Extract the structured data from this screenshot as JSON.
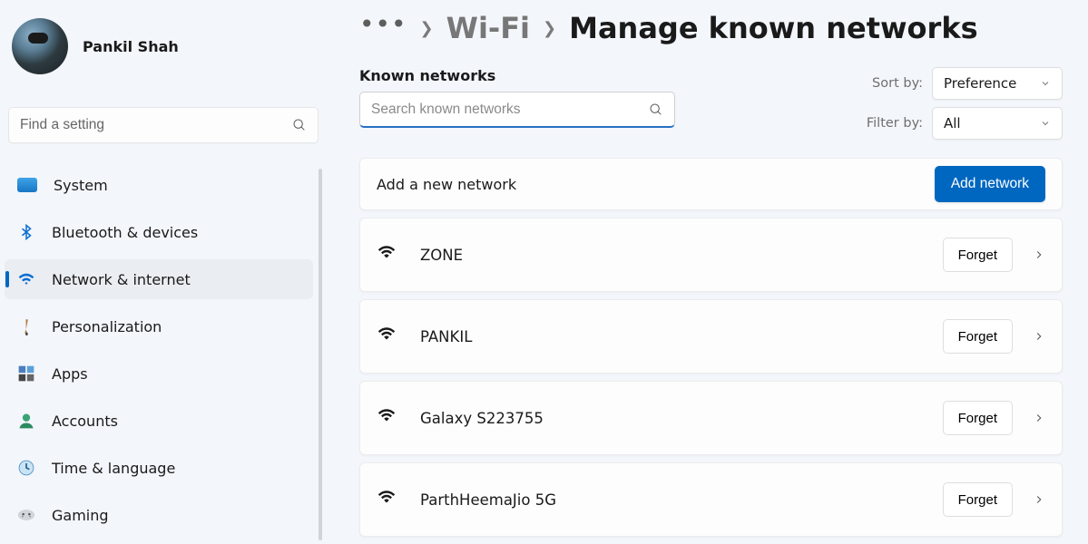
{
  "profile": {
    "name": "Pankil Shah"
  },
  "sidebarSearch": {
    "placeholder": "Find a setting"
  },
  "nav": {
    "items": [
      {
        "label": "System"
      },
      {
        "label": "Bluetooth & devices"
      },
      {
        "label": "Network & internet"
      },
      {
        "label": "Personalization"
      },
      {
        "label": "Apps"
      },
      {
        "label": "Accounts"
      },
      {
        "label": "Time & language"
      },
      {
        "label": "Gaming"
      }
    ]
  },
  "breadcrumb": {
    "wifi": "Wi-Fi",
    "current": "Manage known networks"
  },
  "section": {
    "title": "Known networks"
  },
  "networkSearch": {
    "placeholder": "Search known networks"
  },
  "sort": {
    "label": "Sort by:",
    "value": "Preference"
  },
  "filter": {
    "label": "Filter by:",
    "value": "All"
  },
  "addCard": {
    "label": "Add a new network",
    "button": "Add network"
  },
  "forgetLabel": "Forget",
  "networks": [
    {
      "name": "ZONE"
    },
    {
      "name": "PANKIL"
    },
    {
      "name": "Galaxy S223755"
    },
    {
      "name": "ParthHeemaJio 5G"
    }
  ]
}
